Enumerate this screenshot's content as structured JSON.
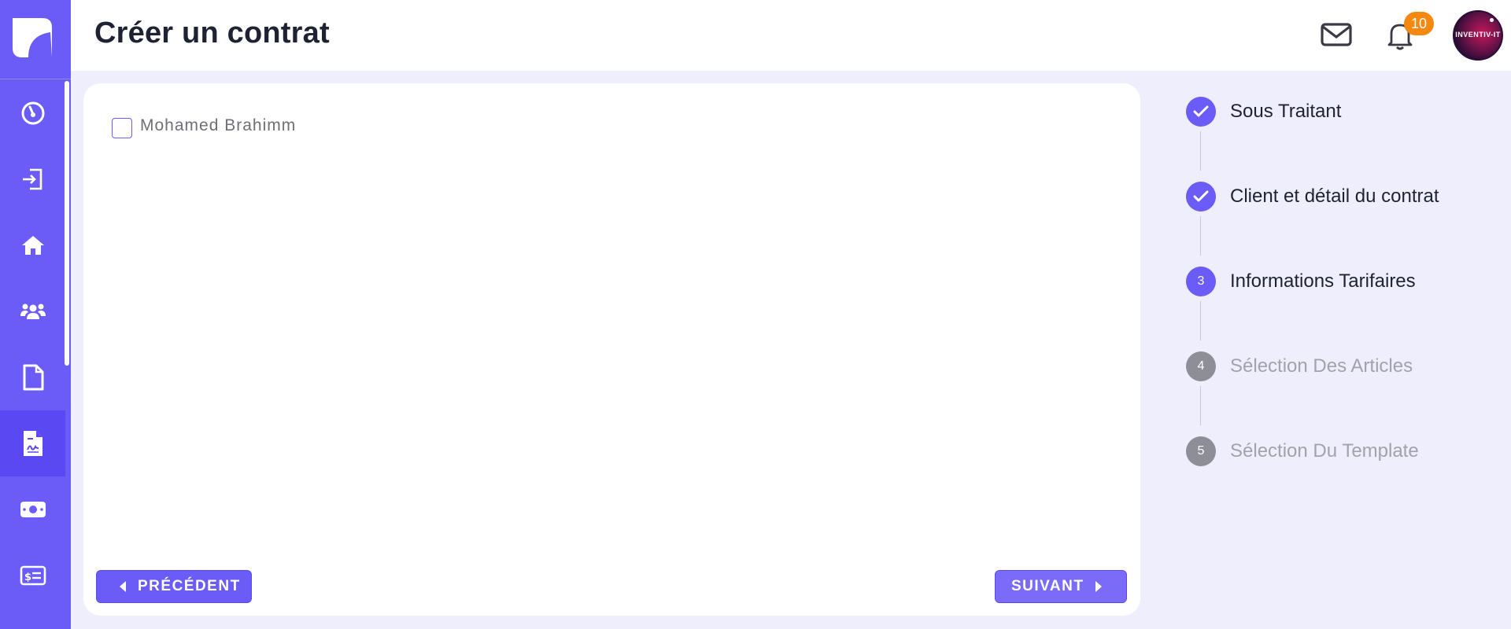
{
  "header": {
    "title": "Créer un contrat",
    "notification_count": "10",
    "avatar_text": "INVENTIV-IT"
  },
  "sidebar": {
    "items": [
      {
        "icon": "dashboard-gauge-icon",
        "active": false
      },
      {
        "icon": "sign-in-icon",
        "active": false
      },
      {
        "icon": "home-icon",
        "active": false
      },
      {
        "icon": "users-icon",
        "active": false
      },
      {
        "icon": "file-icon",
        "active": false
      },
      {
        "icon": "contract-signature-icon",
        "active": true
      },
      {
        "icon": "money-bill-icon",
        "active": false
      },
      {
        "icon": "invoice-card-icon",
        "active": false
      }
    ]
  },
  "form": {
    "checkbox_label": "Mohamed Brahimm",
    "checkbox_checked": false,
    "prev_label": "PRÉCÉDENT",
    "next_label": "SUIVANT"
  },
  "stepper": {
    "steps": [
      {
        "number": "1",
        "label": "Sous Traitant",
        "state": "done"
      },
      {
        "number": "2",
        "label": "Client et détail du contrat",
        "state": "done"
      },
      {
        "number": "3",
        "label": "Informations Tarifaires",
        "state": "current"
      },
      {
        "number": "4",
        "label": "Sélection Des Articles",
        "state": "todo"
      },
      {
        "number": "5",
        "label": "Sélection Du Template",
        "state": "todo"
      }
    ]
  },
  "colors": {
    "accent": "#6b5cf7",
    "background": "#efeefd",
    "badge": "#f5890f"
  }
}
